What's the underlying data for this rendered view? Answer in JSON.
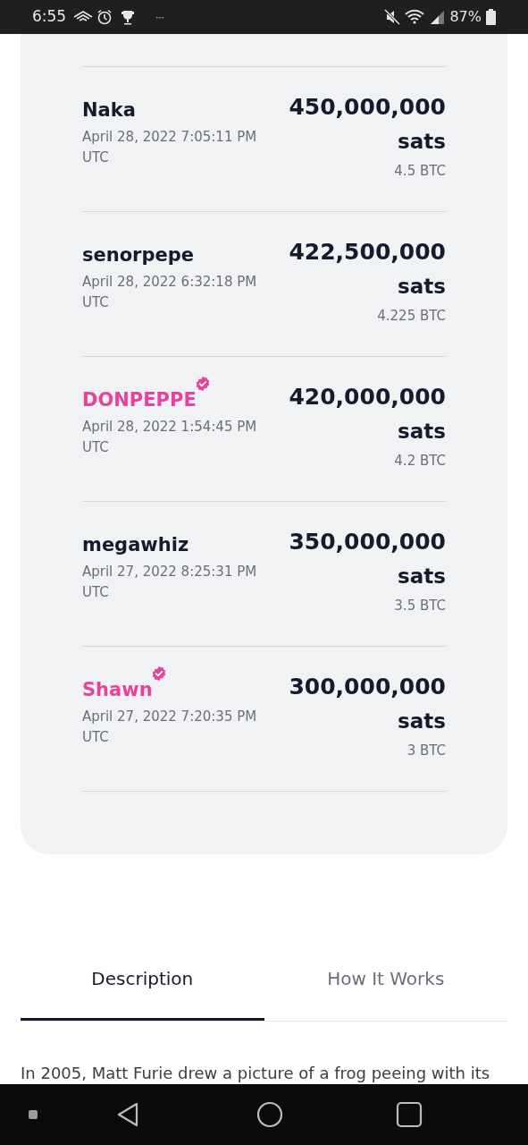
{
  "status_bar": {
    "time": "6:55",
    "more": "···",
    "battery": "87%"
  },
  "bids": [
    {
      "name": "Naka",
      "verified": false,
      "date": "April 28, 2022 7:05:11 PM UTC",
      "amount": "450,000,000",
      "unit": "sats",
      "btc": "4.5 BTC"
    },
    {
      "name": "senorpepe",
      "verified": false,
      "date": "April 28, 2022 6:32:18 PM UTC",
      "amount": "422,500,000",
      "unit": "sats",
      "btc": "4.225 BTC"
    },
    {
      "name": "DONPEPPE",
      "verified": true,
      "date": "April 28, 2022 1:54:45 PM UTC",
      "amount": "420,000,000",
      "unit": "sats",
      "btc": "4.2 BTC"
    },
    {
      "name": "megawhiz",
      "verified": false,
      "date": "April 27, 2022 8:25:31 PM UTC",
      "amount": "350,000,000",
      "unit": "sats",
      "btc": "3.5 BTC"
    },
    {
      "name": "Shawn",
      "verified": true,
      "date": "April 27, 2022 7:20:35 PM UTC",
      "amount": "300,000,000",
      "unit": "sats",
      "btc": "3 BTC"
    }
  ],
  "tabs": [
    {
      "label": "Description",
      "selected": true
    },
    {
      "label": "How It Works",
      "selected": false
    }
  ],
  "description": "In 2005, Matt Furie drew a picture of a frog peeing with its"
}
